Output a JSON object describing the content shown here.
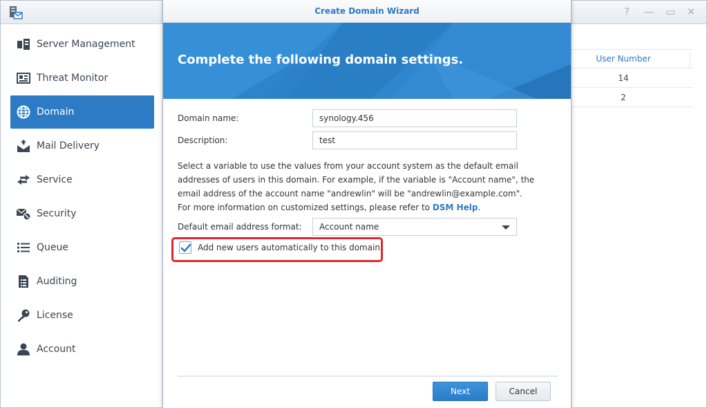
{
  "app": {
    "icon": "mail-server-app-icon",
    "controls": [
      "help-icon",
      "minimize-icon",
      "maximize-icon",
      "close-icon"
    ]
  },
  "sidebar": {
    "items": [
      {
        "label": "Server Management",
        "icon": "server-management-icon",
        "active": false
      },
      {
        "label": "Threat Monitor",
        "icon": "threat-monitor-icon",
        "active": false
      },
      {
        "label": "Domain",
        "icon": "globe-icon",
        "active": true
      },
      {
        "label": "Mail Delivery",
        "icon": "mail-delivery-icon",
        "active": false
      },
      {
        "label": "Service",
        "icon": "arrows-exchange-icon",
        "active": false
      },
      {
        "label": "Security",
        "icon": "security-icon",
        "active": false
      },
      {
        "label": "Queue",
        "icon": "queue-list-icon",
        "active": false
      },
      {
        "label": "Auditing",
        "icon": "auditing-icon",
        "active": false
      },
      {
        "label": "License",
        "icon": "key-icon",
        "active": false
      },
      {
        "label": "Account",
        "icon": "user-icon",
        "active": false
      }
    ]
  },
  "background_table": {
    "header": "User Number",
    "rows": [
      "14",
      "2"
    ]
  },
  "wizard": {
    "title": "Create Domain Wizard",
    "banner_title": "Complete the following domain settings.",
    "domain_name_label": "Domain name:",
    "domain_name_value": "synology.456",
    "description_label": "Description:",
    "description_value": "test",
    "help_text": "Select a variable to use the values from your account system as the default email addresses of users in this domain. For example, if the variable is \"Account name\", the email address of the account name \"andrewlin\" will be \"andrewlin@example.com\". For more information on customized settings, please refer to ",
    "help_link": "DSM Help",
    "help_text_end": ".",
    "email_format_label": "Default email address format:",
    "email_format_value": "Account name",
    "auto_add_label": "Add new users automatically to this domain",
    "auto_add_checked": true,
    "next_button": "Next",
    "cancel_button": "Cancel"
  },
  "colors": {
    "accent": "#2d7bc4",
    "highlight": "#e0262e",
    "banner": "#2f86cf"
  }
}
